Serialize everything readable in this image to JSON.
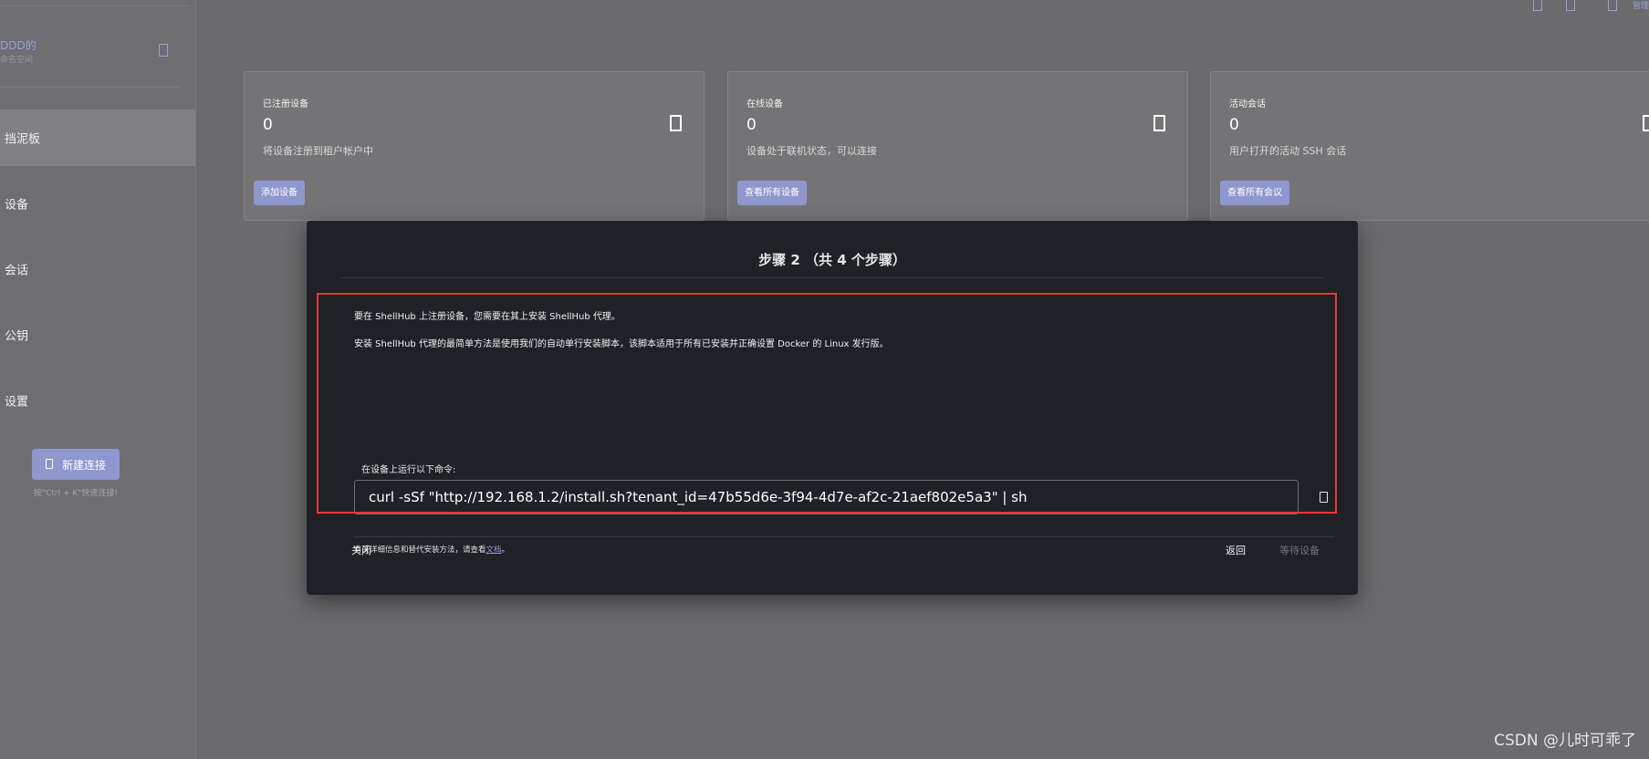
{
  "sidebar": {
    "namespace_name": "DDD的",
    "namespace_subtitle": "命名空间",
    "nav": [
      {
        "label": "挡泥板",
        "active": true
      },
      {
        "label": "设备"
      },
      {
        "label": "会话"
      },
      {
        "label": "公钥"
      },
      {
        "label": "设置"
      }
    ],
    "new_connection_label": "新建连接",
    "shortcut_hint": "按\"Ctrl + K\"快速连接!"
  },
  "topbar": {
    "icons": [
      "notification-icon",
      "chat-icon",
      "account-icon"
    ],
    "manage_label": "管理"
  },
  "cards": [
    {
      "title": "已注册设备",
      "count": "0",
      "desc": "将设备注册到租户帐户中",
      "button": "添加设备",
      "icon": "device-icon"
    },
    {
      "title": "在线设备",
      "count": "0",
      "desc": "设备处于联机状态，可以连接",
      "button": "查看所有设备",
      "icon": "device-icon"
    },
    {
      "title": "活动会话",
      "count": "0",
      "desc": "用户打开的活动 SSH 会话",
      "button": "查看所有会议",
      "icon": "session-icon"
    }
  ],
  "dialog": {
    "title": "步骤 2 （共 4 个步骤）",
    "para1": "要在 ShellHub 上注册设备，您需要在其上安装 ShellHub 代理。",
    "para2": "安装 ShellHub 代理的最简单方法是使用我们的自动单行安装脚本，该脚本适用于所有已安装并正确设置 Docker 的 Linux 发行版。",
    "command_label": "在设备上运行以下命令:",
    "command": "curl -sSf \"http://192.168.1.2/install.sh?tenant_id=47b55d6e-3f94-4d7e-af2c-21aef802e5a3\" | sh",
    "doc_note_prefix": "有关详细信息和替代安装方法，请查看",
    "doc_link": "文档",
    "doc_note_suffix": "。",
    "close_label": "关闭",
    "back_label": "返回",
    "waiting_label": "等待设备"
  },
  "watermark": "CSDN @儿时可乖了",
  "colors": {
    "accent": "#8f97cf",
    "dialog_bg": "#1f2127",
    "highlight_border": "#e53935",
    "page_bg": "#6b6b6d"
  }
}
